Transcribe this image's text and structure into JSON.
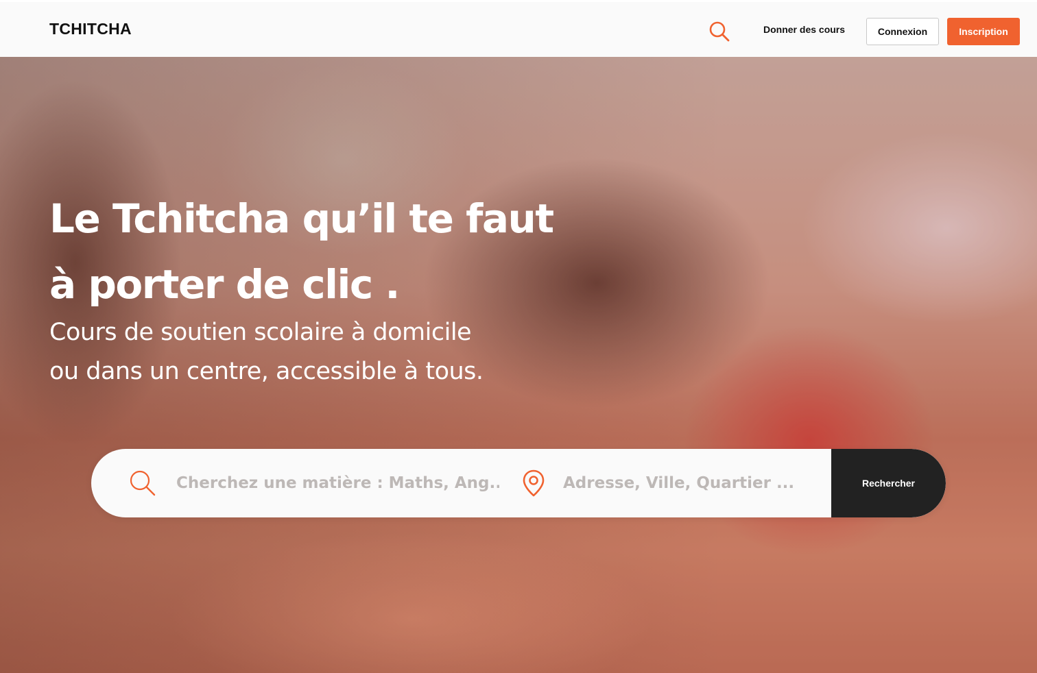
{
  "header": {
    "logo": "TCHITCHA",
    "search_icon": "search-icon",
    "teach_link": "Donner des cours",
    "login_label": "Connexion",
    "signup_label": "Inscription"
  },
  "hero": {
    "title_line1": "Le Tchitcha qu’il te faut",
    "title_line2": "à porter de clic .",
    "subtitle_line1": "Cours de soutien scolaire à domicile",
    "subtitle_line2": "ou dans un centre, accessible à tous.",
    "background": "photo of children writing at a table"
  },
  "search": {
    "subject_icon": "search-icon",
    "subject_placeholder": "Cherchez une matière : Maths, Ang...",
    "subject_value": "",
    "location_icon": "map-pin-icon",
    "location_placeholder": "Adresse, Ville, Quartier ...",
    "location_value": "",
    "button_label": "Rechercher"
  },
  "colors": {
    "accent": "#f0622f",
    "dark": "#222222",
    "header_bg": "#fafafa"
  }
}
